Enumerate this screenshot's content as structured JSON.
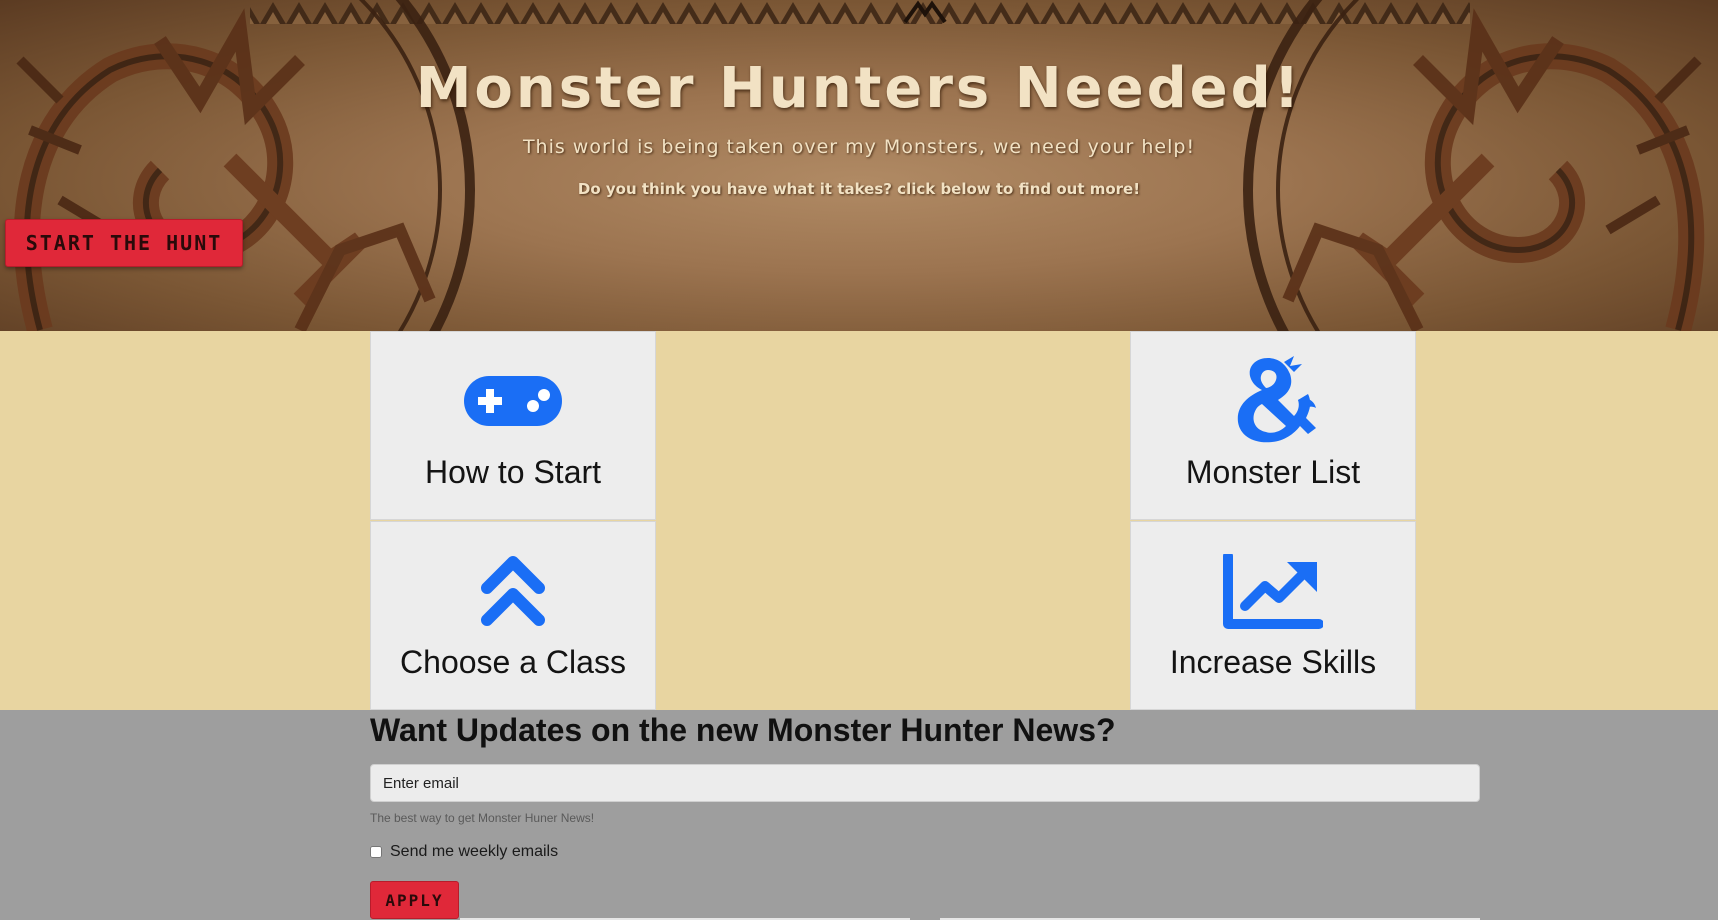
{
  "hero": {
    "title": "Monster Hunters Needed!",
    "subtitle": "This world is being taken over my Monsters, we need your help!",
    "tagline": "Do you think you have what it takes? click below to find out more!",
    "cta_label": "Start the Hunt"
  },
  "cards": {
    "how_to_start": {
      "label": "How to Start",
      "icon": "gamepad-icon"
    },
    "monster_list": {
      "label": "Monster List",
      "icon": "dragon-ampersand-icon"
    },
    "choose_class": {
      "label": "Choose a Class",
      "icon": "double-chevron-up-icon"
    },
    "increase_skills": {
      "label": "Increase Skills",
      "icon": "chart-line-up-icon"
    }
  },
  "newsletter": {
    "title": "Want Updates on the new Monster Hunter News?",
    "email_placeholder": "Enter email",
    "help_text": "The best way to get Monster Huner News!",
    "checkbox_label": "Send me weekly emails",
    "apply_label": "Apply"
  },
  "colors": {
    "accent_red": "#e02839",
    "icon_blue": "#1a6ef5",
    "parchment": "#e8d5a1",
    "card_bg": "#ededed",
    "footer_gray": "#9e9e9e"
  }
}
